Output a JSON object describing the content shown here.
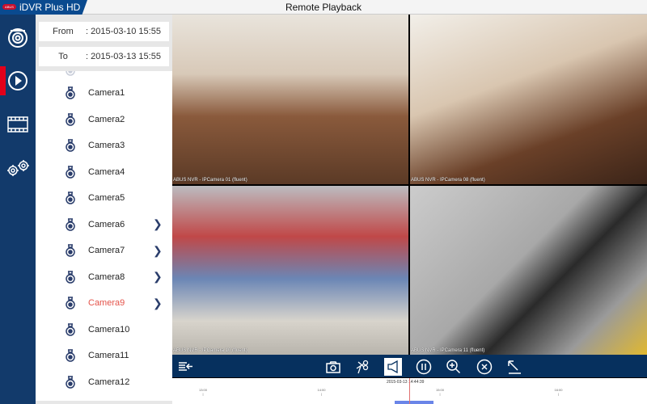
{
  "app": {
    "logo": "ABUS",
    "title": "iDVR Plus HD",
    "window_title": "Remote Playback"
  },
  "rail": [
    {
      "icon": "camera-dome-icon"
    },
    {
      "icon": "playback-icon",
      "active": true
    },
    {
      "icon": "film-icon"
    },
    {
      "icon": "gears-icon"
    }
  ],
  "range": {
    "from_label": "From",
    "from_value": ": 2015-03-10  15:55",
    "to_label": "To",
    "to_value": ": 2015-03-13  15:55"
  },
  "cameras": [
    {
      "name": "Camera1",
      "chevron": false
    },
    {
      "name": "Camera2",
      "chevron": false
    },
    {
      "name": "Camera3",
      "chevron": false
    },
    {
      "name": "Camera4",
      "chevron": false
    },
    {
      "name": "Camera5",
      "chevron": false
    },
    {
      "name": "Camera6",
      "chevron": true
    },
    {
      "name": "Camera7",
      "chevron": true
    },
    {
      "name": "Camera8",
      "chevron": true
    },
    {
      "name": "Camera9",
      "chevron": true,
      "selected": true
    },
    {
      "name": "Camera10",
      "chevron": false
    },
    {
      "name": "Camera11",
      "chevron": false
    },
    {
      "name": "Camera12",
      "chevron": false
    }
  ],
  "panes": [
    {
      "caption": "ABUS NVR - IPCamera 01 (fluent)"
    },
    {
      "caption": "ABUS NVR - IPCamera 08 (fluent)"
    },
    {
      "caption": "ABUS NVR - IPCamera 10 (fluent)"
    },
    {
      "caption": "ABUS NVR - IPCamera 11 (fluent)"
    }
  ],
  "timeline": {
    "cursor": "2015-03-13 14:44:39",
    "ticks": [
      "13:00",
      "14:00",
      "15:00",
      "16:00"
    ]
  },
  "colors": {
    "brand": "#0a4a8f",
    "rail": "#123a6b",
    "toolbar": "#06305e",
    "accent": "#e2001a"
  }
}
